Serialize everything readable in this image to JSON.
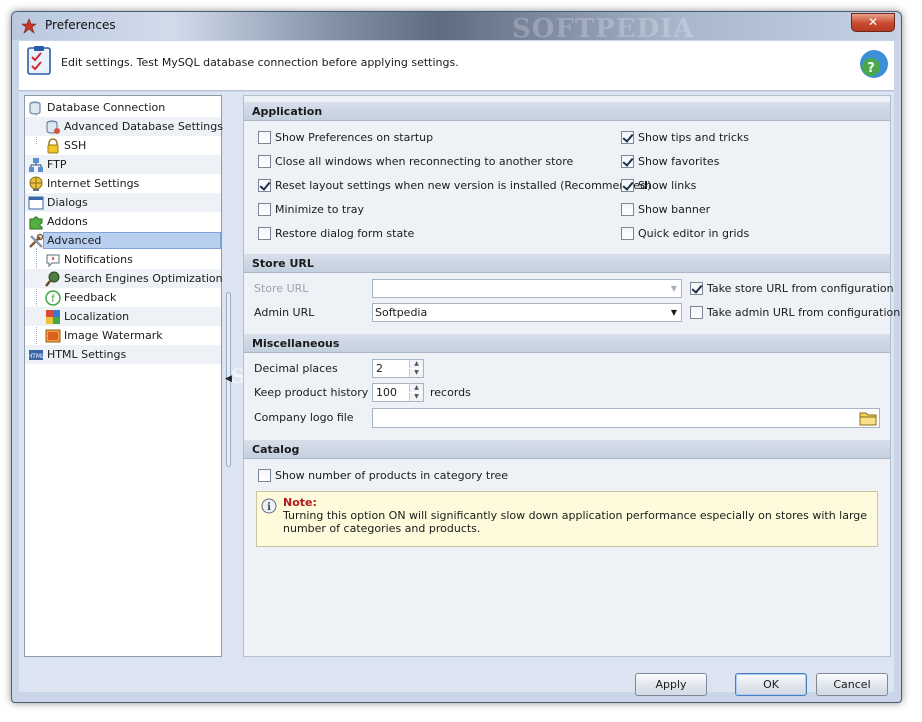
{
  "window": {
    "title": "Preferences",
    "watermark": "SOFTPEDIA",
    "close_label": "✕"
  },
  "info": {
    "text": "Edit settings. Test MySQL database connection before applying settings."
  },
  "tree": {
    "items": [
      {
        "label": "Database Connection",
        "icon": "database-icon"
      },
      {
        "label": "Advanced Database Settings",
        "icon": "database-settings-icon"
      },
      {
        "label": "SSH",
        "icon": "lock-icon"
      },
      {
        "label": "FTP",
        "icon": "network-icon"
      },
      {
        "label": "Internet Settings",
        "icon": "globe-icon"
      },
      {
        "label": "Dialogs",
        "icon": "dialog-icon"
      },
      {
        "label": "Addons",
        "icon": "puzzle-icon"
      },
      {
        "label": "Advanced",
        "icon": "tools-icon"
      },
      {
        "label": "Notifications",
        "icon": "notification-icon"
      },
      {
        "label": "Search Engines Optimization",
        "icon": "seo-icon"
      },
      {
        "label": "Feedback",
        "icon": "feedback-icon"
      },
      {
        "label": "Localization",
        "icon": "localization-icon"
      },
      {
        "label": "Image Watermark",
        "icon": "image-icon"
      },
      {
        "label": "HTML Settings",
        "icon": "html-icon"
      }
    ]
  },
  "application": {
    "title": "Application",
    "left": [
      {
        "label": "Show Preferences on startup",
        "checked": false
      },
      {
        "label": "Close all windows when reconnecting to another store",
        "checked": false
      },
      {
        "label": "Reset layout settings when new version is installed (Recommended)",
        "checked": true
      },
      {
        "label": "Minimize to tray",
        "checked": false
      },
      {
        "label": "Restore dialog form state",
        "checked": false
      }
    ],
    "right": [
      {
        "label": "Show tips and tricks",
        "checked": true
      },
      {
        "label": "Show favorites",
        "checked": true
      },
      {
        "label": "Show links",
        "checked": true
      },
      {
        "label": "Show banner",
        "checked": false
      },
      {
        "label": "Quick editor in grids",
        "checked": false
      }
    ]
  },
  "store_url": {
    "title": "Store URL",
    "store_url_label": "Store URL",
    "store_url_value": "",
    "take_store_label": "Take store URL from configuration",
    "take_store_checked": true,
    "admin_url_label": "Admin URL",
    "admin_url_value": "Softpedia",
    "take_admin_label": "Take admin URL from configuration",
    "take_admin_checked": false
  },
  "misc": {
    "title": "Miscellaneous",
    "decimal_label": "Decimal places",
    "decimal_value": "2",
    "history_label": "Keep product history of",
    "history_value": "100",
    "history_suffix": "records",
    "logo_label": "Company logo file",
    "logo_value": ""
  },
  "catalog": {
    "title": "Catalog",
    "show_count_label": "Show number of products in category tree",
    "show_count_checked": false,
    "note_title": "Note:",
    "note_text": "Turning this option ON will significantly slow down application performance especially on stores with large number of categories and products."
  },
  "buttons": {
    "apply": "Apply",
    "ok": "OK",
    "cancel": "Cancel"
  }
}
